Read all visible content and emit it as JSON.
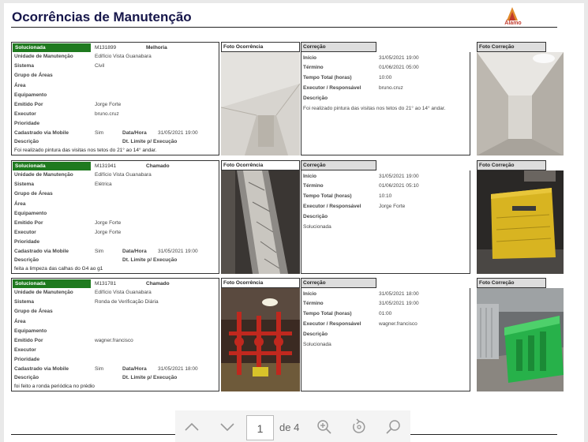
{
  "report": {
    "title": "Ocorrências de Manutenção",
    "logo_text": "Álamo"
  },
  "labels": {
    "unidade": "Unidade de Manutenção",
    "sistema": "Sistema",
    "grupo": "Grupo de Áreas",
    "area": "Área",
    "equipamento": "Equipamento",
    "emitido": "Emitido Por",
    "executor": "Executor",
    "prioridade": "Prioridade",
    "cadastrado": "Cadastrado via Mobile",
    "descricao": "Descrição",
    "data_hora": "Data/Hora",
    "dt_limite": "Dt. Limite p/ Execução",
    "foto_ocorrencia": "Foto Ocorrência",
    "correcao": "Correção",
    "foto_correcao": "Foto Correção",
    "inicio": "Início",
    "termino": "Término",
    "tempo_total": "Tempo Total (horas)",
    "executor_resp": "Executor / Responsável"
  },
  "records": [
    {
      "status": "Solucionada",
      "code": "M131899",
      "type": "Melhoria",
      "unidade": "Edifício Vista Guanabara",
      "sistema": "Civil",
      "emitido": "Jorge Forte",
      "executor": "bruno.cruz",
      "cadastrado": "Sim",
      "data_hora": "31/05/2021 19:00",
      "descricao": "Foi realizado pintura das visitas nos tetos do 21° ao 14° andar.",
      "corr": {
        "inicio": "31/05/2021 19:00",
        "termino": "01/06/2021 05:00",
        "tempo": "10:00",
        "executor": "bruno.cruz",
        "descricao": "Foi realizado pintura das visitas nos tetos do 21° ao 14° andar."
      }
    },
    {
      "status": "Solucionada",
      "code": "M131941",
      "type": "Chamado",
      "unidade": "Edifício Vista Guanabara",
      "sistema": "Elétrica",
      "emitido": "Jorge Forte",
      "executor": "Jorge Forte",
      "cadastrado": "Sim",
      "data_hora": "31/05/2021 19:00",
      "descricao": "feita a limpeza das calhas do G4 ao g1",
      "corr": {
        "inicio": "31/05/2021 19:00",
        "termino": "01/06/2021 05:10",
        "tempo": "10:10",
        "executor": "Jorge Forte",
        "descricao": "Solucionada"
      }
    },
    {
      "status": "Solucionada",
      "code": "M131781",
      "type": "Chamado",
      "unidade": "Edifício Vista Guanabara",
      "sistema": "Ronda de Verificação Diária",
      "emitido": "wagner.francisco",
      "executor": "",
      "cadastrado": "Sim",
      "data_hora": "31/05/2021 18:00",
      "descricao": "foi feito a ronda periódica no prédio",
      "corr": {
        "inicio": "31/05/2021 18:00",
        "termino": "31/05/2021 19:00",
        "tempo": "01:00",
        "executor": "wagner.francisco",
        "descricao": "Solucionada"
      }
    }
  ],
  "pager": {
    "current_page": "1",
    "of_label": "de 4"
  }
}
